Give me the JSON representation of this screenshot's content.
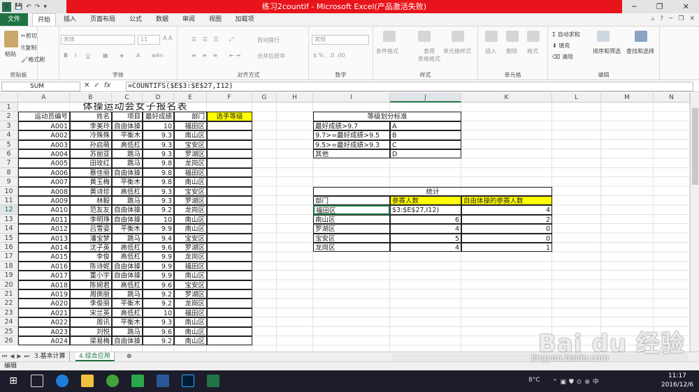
{
  "window": {
    "title": "练习2countif - Microsoft Excel(产品激活失败)",
    "controls": [
      "?",
      "❐",
      "─",
      "❐",
      "✕"
    ]
  },
  "ribbon_tabs": [
    "文件",
    "开始",
    "插入",
    "页面布局",
    "公式",
    "数据",
    "审阅",
    "视图",
    "加载项"
  ],
  "ribbon": {
    "clipboard": {
      "paste": "粘贴",
      "cut": "剪切",
      "copy": "复制",
      "format_painter": "格式刷",
      "label": "剪贴板"
    },
    "font": {
      "name": "宋体",
      "size": "11",
      "label": "字体"
    },
    "align": {
      "wrap": "自动换行",
      "merge": "合并后居中",
      "label": "对齐方式"
    },
    "number": {
      "format": "常规",
      "label": "数字"
    },
    "styles": {
      "cond": "条件格式",
      "table": "套用\n表格格式",
      "cell": "单元格样式",
      "label": "样式"
    },
    "cells": {
      "insert": "插入",
      "delete": "删除",
      "format": "格式",
      "label": "单元格"
    },
    "edit": {
      "autosum": "Σ 自动求和",
      "fill": "填充",
      "clear": "清除",
      "sort": "排序和筛选",
      "find": "查找和选择",
      "label": "编辑"
    }
  },
  "namebox": "SUM",
  "formula": "=COUNTIFS($E$3:$E$27,I12)",
  "columns": [
    "A",
    "B",
    "C",
    "D",
    "E",
    "F",
    "G",
    "H",
    "I",
    "J",
    "K",
    "L",
    "M",
    "N"
  ],
  "rows": [
    "1",
    "2",
    "3",
    "4",
    "5",
    "6",
    "7",
    "8",
    "9",
    "10",
    "11",
    "12",
    "13",
    "14",
    "15",
    "16",
    "17",
    "18",
    "19",
    "20",
    "21",
    "22",
    "23",
    "24",
    "25",
    "26"
  ],
  "table_title": "体操运动会女子报名表",
  "headers": [
    "运动员编号",
    "姓名",
    "项目",
    "最好成绩",
    "部门",
    "选手等级"
  ],
  "athletes": [
    [
      "A001",
      "李美玲",
      "自由体操",
      "10",
      "福田区"
    ],
    [
      "A002",
      "冷殊殊",
      "平衡木",
      "9.3",
      "南山区"
    ],
    [
      "A003",
      "孙启萌",
      "高低杠",
      "9.3",
      "宝安区"
    ],
    [
      "A004",
      "苏丽亚",
      "跳马",
      "9.3",
      "罗湖区"
    ],
    [
      "A005",
      "田玫红",
      "跳马",
      "9.8",
      "龙岗区"
    ],
    [
      "A006",
      "蔡佳丽",
      "自由体操",
      "9.8",
      "福田区"
    ],
    [
      "A007",
      "黄玉梅",
      "平衡木",
      "9.8",
      "南山区"
    ],
    [
      "A008",
      "黄诗珍",
      "高低杠",
      "9.3",
      "宝安区"
    ],
    [
      "A009",
      "林毅",
      "跳马",
      "9.3",
      "罗湖区"
    ],
    [
      "A010",
      "范友友",
      "自由体操",
      "9.2",
      "龙岗区"
    ],
    [
      "A011",
      "李明琤",
      "自由体操",
      "10",
      "南山区"
    ],
    [
      "A012",
      "吕雪姿",
      "平衡木",
      "9.9",
      "南山区"
    ],
    [
      "A013",
      "潘宝梦",
      "跳马",
      "9.4",
      "宝安区"
    ],
    [
      "A014",
      "沈子英",
      "高低杠",
      "9.6",
      "罗湖区"
    ],
    [
      "A015",
      "李俊",
      "高低杠",
      "9.9",
      "龙岗区"
    ],
    [
      "A016",
      "陈诗妮",
      "自由体操",
      "9.9",
      "福田区"
    ],
    [
      "A017",
      "董小宇",
      "自由体操",
      "9.9",
      "南山区"
    ],
    [
      "A018",
      "陈婉君",
      "高低杠",
      "9.6",
      "宝安区"
    ],
    [
      "A019",
      "周佩丽",
      "跳马",
      "9.2",
      "罗湖区"
    ],
    [
      "A020",
      "李俊丽",
      "平衡木",
      "9.2",
      "龙岗区"
    ],
    [
      "A021",
      "宋兰英",
      "高低杠",
      "10",
      "福田区"
    ],
    [
      "A022",
      "周讯",
      "平衡木",
      "9.3",
      "南山区"
    ],
    [
      "A023",
      "刘悦",
      "跳马",
      "9.6",
      "南山区"
    ],
    [
      "A024",
      "梁易梅",
      "自由体操",
      "9.2",
      "南山区"
    ]
  ],
  "grade_title": "等级划分标准",
  "grades": [
    [
      "最好成绩>9.7",
      "A"
    ],
    [
      "9.7>=最好成绩>9.5",
      "B"
    ],
    [
      "9.5>=最好成绩>9.3",
      "C"
    ],
    [
      "其他",
      "D"
    ]
  ],
  "stats_title": "统计",
  "stats_headers": [
    "部门",
    "参赛人数",
    "自由体操的参赛人数"
  ],
  "stats": [
    [
      "福田区",
      "$3:$E$27,I12)",
      "4"
    ],
    [
      "南山区",
      "6",
      "2"
    ],
    [
      "罗湖区",
      "4",
      "0"
    ],
    [
      "宝安区",
      "5",
      "0"
    ],
    [
      "龙岗区",
      "4",
      "1"
    ]
  ],
  "sheet_tabs": [
    "3.基本计算",
    "4.综合应用"
  ],
  "status": "编辑",
  "taskbar": {
    "temp": "8°C",
    "time": "11:17",
    "date": "2016/12/6"
  },
  "watermark": "Bai du 经验",
  "watermark_url": "jingyan.baidu.com",
  "colors": {
    "excel_green": "#217346",
    "title_red": "#e8141b",
    "highlight": "#ffff00"
  }
}
